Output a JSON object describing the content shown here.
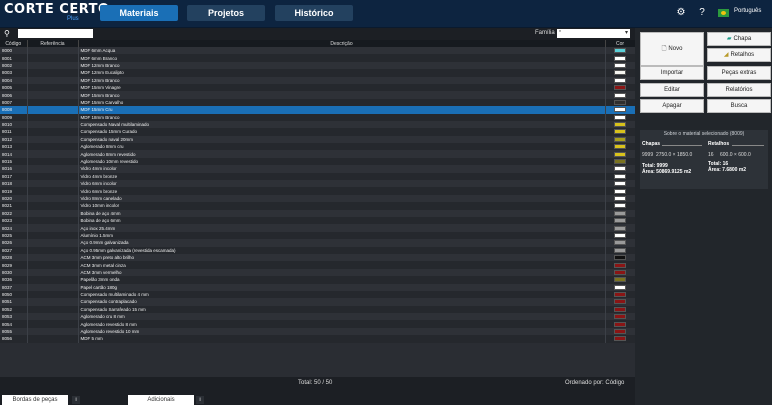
{
  "header": {
    "logo_text": "CORTE CERTO",
    "logo_sub": "Plus",
    "tabs": [
      "Materiais",
      "Projetos",
      "Histórico"
    ],
    "language": "Português",
    "icons": [
      "gear-icon",
      "help-icon"
    ]
  },
  "search": {
    "value": "",
    "placeholder": "",
    "filter_label": "Família",
    "filter_value": "*"
  },
  "table": {
    "columns": [
      "Código",
      "Referência",
      "Descrição",
      "Cor"
    ],
    "selected_index": 8,
    "rows": [
      {
        "code": "8000",
        "ref": "",
        "desc": "MDF 6mm Acqua",
        "color": "#5bd0d8"
      },
      {
        "code": "8001",
        "ref": "",
        "desc": "MDF 6mm Branco",
        "color": "#ffffff"
      },
      {
        "code": "8002",
        "ref": "",
        "desc": "MDF 12mm Branco",
        "color": "#ffffff"
      },
      {
        "code": "8003",
        "ref": "",
        "desc": "MDF 12mm Eucalipto",
        "color": "#f5f5f0"
      },
      {
        "code": "8004",
        "ref": "",
        "desc": "MDF 12mm Branco",
        "color": "#ffffff"
      },
      {
        "code": "8005",
        "ref": "",
        "desc": "MDF 15mm Vinagre",
        "color": "#8a1515"
      },
      {
        "code": "8006",
        "ref": "",
        "desc": "MDF 15mm Branco",
        "color": "#ffffff"
      },
      {
        "code": "8007",
        "ref": "",
        "desc": "MDF 15mm Carvalho",
        "color": "#2f2f2f"
      },
      {
        "code": "8008",
        "ref": "",
        "desc": "MDF 15mm Cru",
        "color": "#ffffff"
      },
      {
        "code": "8009",
        "ref": "",
        "desc": "MDF 18mm Branco",
        "color": "#ffffff"
      },
      {
        "code": "8010",
        "ref": "",
        "desc": "Compensado Naval multilaminado",
        "color": "#d8c21c"
      },
      {
        "code": "8011",
        "ref": "",
        "desc": "Compensado 15mm Curado",
        "color": "#d8c21c"
      },
      {
        "code": "8012",
        "ref": "",
        "desc": "Compensado naval 20mm",
        "color": "#a8a01c"
      },
      {
        "code": "8013",
        "ref": "",
        "desc": "Aglomerado 8mm cru",
        "color": "#d8c21c"
      },
      {
        "code": "8014",
        "ref": "",
        "desc": "Aglomerado 8mm revestido",
        "color": "#d8c21c"
      },
      {
        "code": "8015",
        "ref": "",
        "desc": "Aglomerado 10mm revestido",
        "color": "#7a7320"
      },
      {
        "code": "8016",
        "ref": "",
        "desc": "Vidro 4mm incolor",
        "color": "#ffffff"
      },
      {
        "code": "8017",
        "ref": "",
        "desc": "Vidro 4mm bronze",
        "color": "#ffffff"
      },
      {
        "code": "8018",
        "ref": "",
        "desc": "Vidro 6mm incolor",
        "color": "#ffffff"
      },
      {
        "code": "8019",
        "ref": "",
        "desc": "Vidro 6mm bronze",
        "color": "#ffffff"
      },
      {
        "code": "8020",
        "ref": "",
        "desc": "Vidro 8mm canelado",
        "color": "#ffffff"
      },
      {
        "code": "8021",
        "ref": "",
        "desc": "Vidro 10mm incolor",
        "color": "#ffffff"
      },
      {
        "code": "8022",
        "ref": "",
        "desc": "Bobina de aço 4mm",
        "color": "#9a9a9a"
      },
      {
        "code": "8023",
        "ref": "",
        "desc": "Bobina de aço 6mm",
        "color": "#9a9a9a"
      },
      {
        "code": "8024",
        "ref": "",
        "desc": "Aço inox 25.4mm",
        "color": "#9a9a9a"
      },
      {
        "code": "8025",
        "ref": "",
        "desc": "Alumínio 1.5mm",
        "color": "#ffffff"
      },
      {
        "code": "8026",
        "ref": "",
        "desc": "Aço 0.9mm galvanizada",
        "color": "#9a9a9a"
      },
      {
        "code": "8027",
        "ref": "",
        "desc": "Aço 0.95mm galvanizada (revestida escamada)",
        "color": "#9a9a9a"
      },
      {
        "code": "8028",
        "ref": "",
        "desc": "ACM 3mm preto alto brilho",
        "color": "#111111"
      },
      {
        "code": "8029",
        "ref": "",
        "desc": "ACM 3mm metal cinza",
        "color": "#8a1515"
      },
      {
        "code": "8030",
        "ref": "",
        "desc": "ACM 3mm vermelho",
        "color": "#8a1515"
      },
      {
        "code": "8036",
        "ref": "",
        "desc": "Papelão 3mm onda",
        "color": "#7a7320"
      },
      {
        "code": "8037",
        "ref": "",
        "desc": "Papel cartão 180g",
        "color": "#ffffff"
      },
      {
        "code": "8050",
        "ref": "",
        "desc": "Compensado multilaminado 4 mm",
        "color": "#8a1515"
      },
      {
        "code": "8051",
        "ref": "",
        "desc": "Compensado contraplacado",
        "color": "#8a1515"
      },
      {
        "code": "8052",
        "ref": "",
        "desc": "Compensado Sarrafeado 15 mm",
        "color": "#8a1515"
      },
      {
        "code": "8053",
        "ref": "",
        "desc": "Aglomerado cru 8 mm",
        "color": "#8a1515"
      },
      {
        "code": "8054",
        "ref": "",
        "desc": "Aglomerado revestido 8 mm",
        "color": "#8a1515"
      },
      {
        "code": "8055",
        "ref": "",
        "desc": "Aglomerado revestido 10 mm",
        "color": "#8a1515"
      },
      {
        "code": "8056",
        "ref": "",
        "desc": "MDF 5 mm",
        "color": "#8a1515"
      }
    ]
  },
  "footer": {
    "total": "Total: 50 / 50",
    "ordered_by": "Ordenado por: Código"
  },
  "bottom_tabs": [
    "Bordas de peças",
    "Adicionais"
  ],
  "right_panel": {
    "buttons": {
      "novo": "Novo",
      "chapa": "Chapa",
      "retalhos": "Retalhos",
      "importar": "Importar",
      "pecas_extras": "Peças extras",
      "editar": "Editar",
      "relatorios": "Relatórios",
      "apagar": "Apagar",
      "busca": "Busca"
    },
    "preview_title": "Sobre o material selecionado (8009)",
    "chapas_label": "Chapas",
    "retalhos_label": "Retalhos",
    "chapa_code": "9999",
    "chapa_dims": "2750.0 × 1850.0",
    "retalho_code": "16",
    "retalho_dims": "600.0 × 600.0",
    "chapa_total": "Total: 9999",
    "chapa_area": "Área: 50869.9125 m2",
    "retalho_total": "Total: 16",
    "retalho_area": "Área: 7.6800 m2"
  }
}
